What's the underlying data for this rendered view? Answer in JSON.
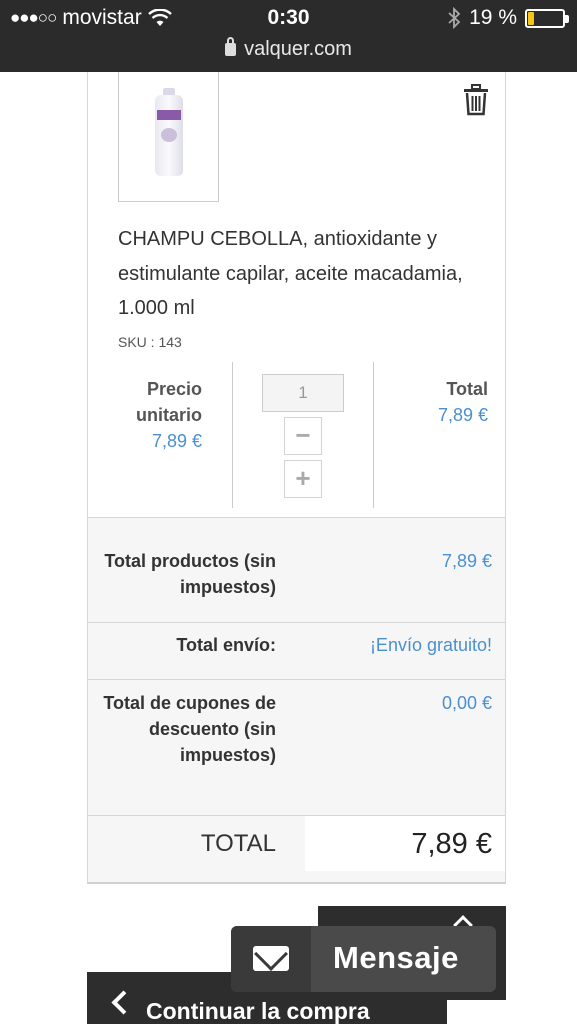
{
  "status_bar": {
    "carrier": "movistar",
    "signal_dots": "●●●○○",
    "time": "0:30",
    "battery_percent": "19 %",
    "battery_level": 0.19,
    "url": "valquer.com"
  },
  "product": {
    "name": "CHAMPU CEBOLLA, antioxidante y estimulante capilar, aceite macadamia, 1.000 ml",
    "sku": "SKU : 143",
    "unit_price_label_1": "Precio",
    "unit_price_label_2": "unitario",
    "unit_price": "7,89 €",
    "quantity": "1",
    "minus_label": "−",
    "plus_label": "+",
    "total_label": "Total",
    "total_value": "7,89 €"
  },
  "summary": {
    "products_label": "Total productos (sin impuestos)",
    "products_value": "7,89 €",
    "shipping_label": "Total envío:",
    "shipping_value": "¡Envío gratuito!",
    "coupons_label": "Total de cupones de descuento (sin impuestos)",
    "coupons_value": "0,00 €",
    "grand_total_label": "TOTAL",
    "grand_total_value": "7,89 €"
  },
  "actions": {
    "message_label": "Mensaje",
    "continue_label": "Continuar la compra"
  },
  "colors": {
    "accent_blue": "#4a90d0",
    "dark_button": "#2d2d2d",
    "status_bar": "#2b2b2b"
  }
}
